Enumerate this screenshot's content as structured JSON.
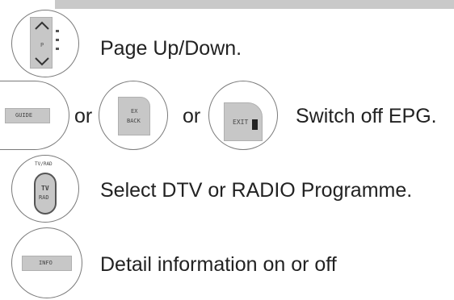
{
  "header": {
    "bar_color": "#c9c9c9"
  },
  "rows": {
    "page": {
      "label": "Page Up/Down.",
      "icon": "page-up-down-icon"
    },
    "switch_off": {
      "label": "Switch off EPG.",
      "or_1": "or",
      "or_2": "or",
      "key_1_text": "GUIDE",
      "key_2_text_line1": "EX",
      "key_2_text_line2": "BACK",
      "key_3_text": "EXIT"
    },
    "tv_radio": {
      "label": "Select DTV or RADIO Programme.",
      "key_top": "TV/RAD",
      "key_text_line1": "TV",
      "key_text_line2": "RAD"
    },
    "info": {
      "label": "Detail information on or off",
      "key_text": "INFO"
    }
  }
}
